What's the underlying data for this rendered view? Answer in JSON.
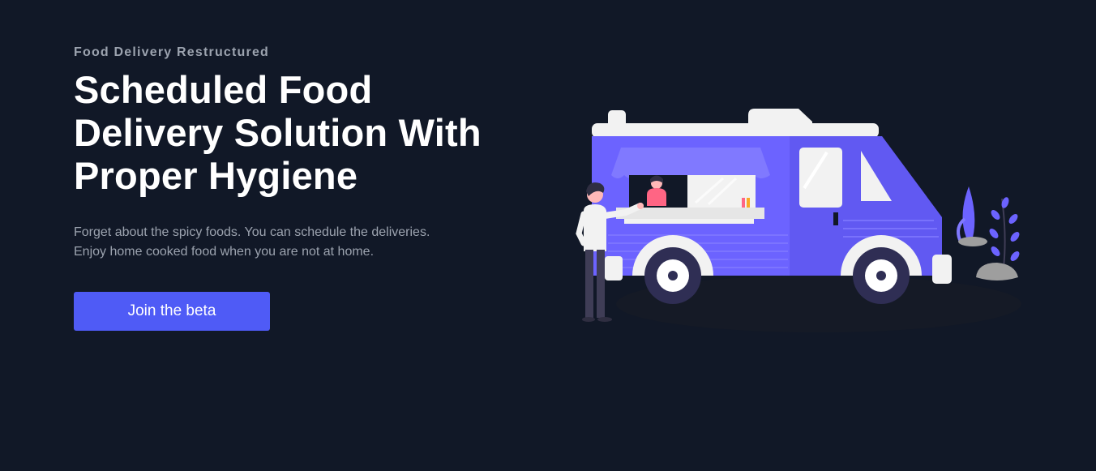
{
  "hero": {
    "eyebrow": "Food Delivery Restructured",
    "headline": "Scheduled Food Delivery Solution With Proper Hygiene",
    "description": "Forget about the spicy foods. You can schedule the deliveries. Enjoy home cooked food when you are not at home.",
    "cta_label": "Join the beta"
  },
  "illustration": {
    "subject": "food-truck-illustration",
    "accent_color": "#6c63ff",
    "background_color": "#111827",
    "button_color": "#4f5bf6"
  }
}
